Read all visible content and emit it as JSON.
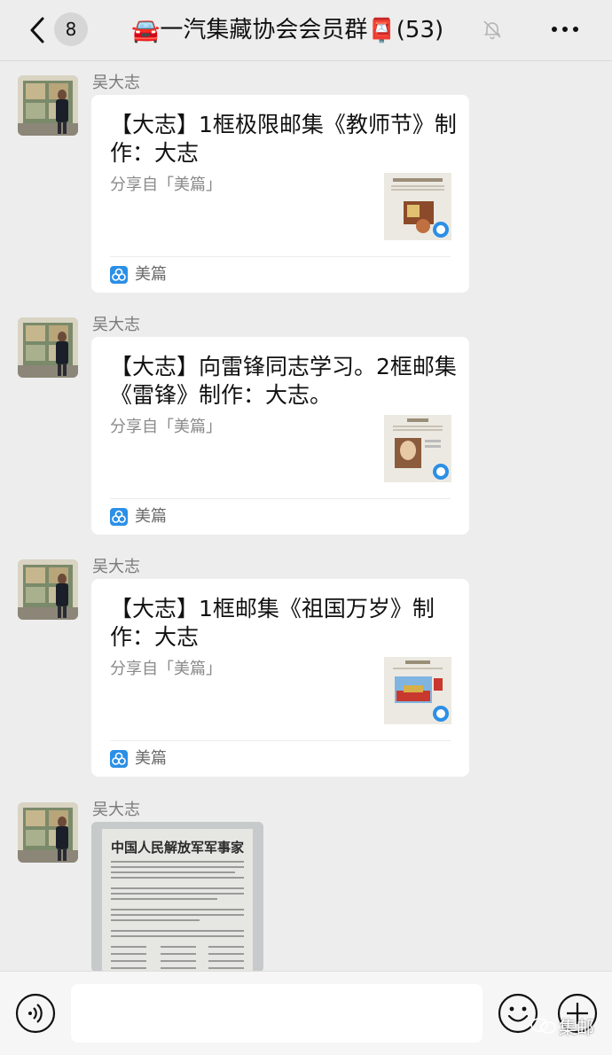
{
  "header": {
    "unread_count": "8",
    "title_prefix_emoji": "🚘",
    "title": "一汽集藏协会会员群",
    "title_suffix_emoji": "📮",
    "member_count": "(53)"
  },
  "messages": [
    {
      "sender": "吴大志",
      "type": "link",
      "title": "【大志】1框极限邮集《教师节》制作：大志",
      "desc": "分享自「美篇」",
      "source": "美篇",
      "thumb_icon": "stamp-album-page-thumbnail"
    },
    {
      "sender": "吴大志",
      "type": "link",
      "title": "【大志】向雷锋同志学习。2框邮集《雷锋》制作：大志。",
      "desc": "分享自「美篇」",
      "source": "美篇",
      "thumb_icon": "stamp-album-page-thumbnail"
    },
    {
      "sender": "吴大志",
      "type": "link",
      "title": "【大志】1框邮集《祖国万岁》制作：大志",
      "desc": "分享自「美篇」",
      "source": "美篇",
      "thumb_icon": "stamp-album-page-thumbnail"
    },
    {
      "sender": "吴大志",
      "type": "image",
      "image_heading": "中国人民解放军军事家"
    }
  ],
  "watermark": "集邮",
  "colors": {
    "background": "#ededed",
    "bubble": "#ffffff",
    "source_icon": "#2b8fe6"
  }
}
